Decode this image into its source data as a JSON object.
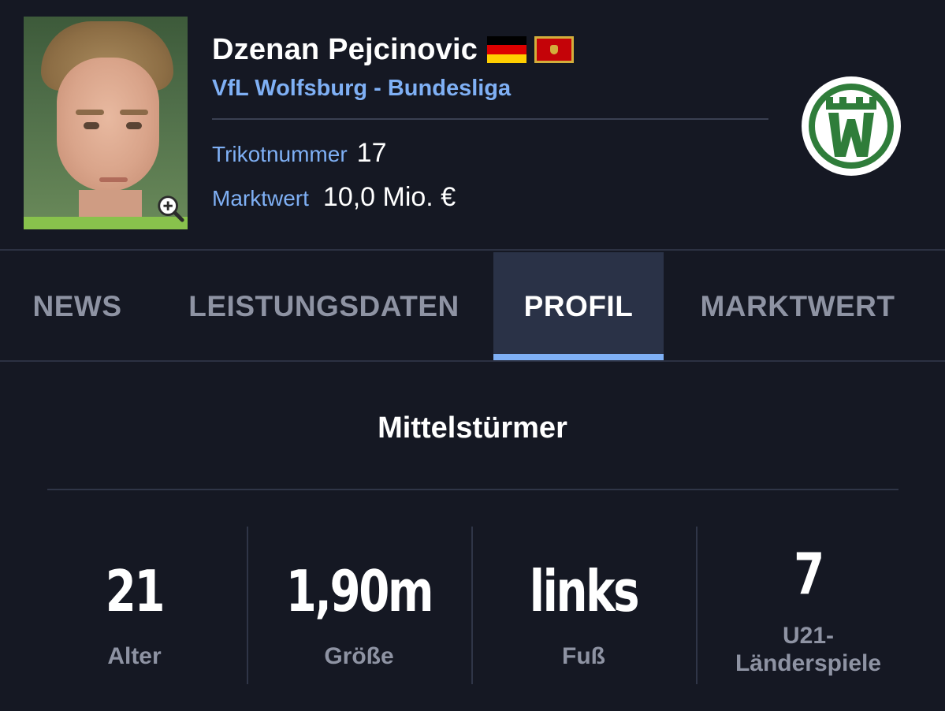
{
  "player": {
    "name": "Dzenan Pejcinovic",
    "club_line": "VfL Wolfsburg - Bundesliga",
    "shirt_label": "Trikotnummer",
    "shirt_value": "17",
    "value_label": "Marktwert",
    "value_value": "10,0 Mio. €",
    "flags": [
      "flag-germany",
      "flag-montenegro"
    ],
    "club_logo": "vfl-wolfsburg-logo",
    "photo_icon": "zoom-in-icon"
  },
  "tabs": [
    {
      "label": "NEWS",
      "active": false
    },
    {
      "label": "LEISTUNGSDATEN",
      "active": false
    },
    {
      "label": "PROFIL",
      "active": true
    },
    {
      "label": "MARKTWERT",
      "active": false
    }
  ],
  "profile": {
    "position": "Mittelstürmer",
    "stats": [
      {
        "value": "21",
        "label": "Alter"
      },
      {
        "value": "1,90m",
        "label": "Größe"
      },
      {
        "value": "links",
        "label": "Fuß"
      },
      {
        "value": "7",
        "label": "U21-\nLänderspiele"
      }
    ]
  },
  "colors": {
    "background": "#151823",
    "accent": "#7fb0f5",
    "active_tab": "#2a3247",
    "muted_text": "#8e93a3",
    "club_green": "#2f7d3a"
  }
}
